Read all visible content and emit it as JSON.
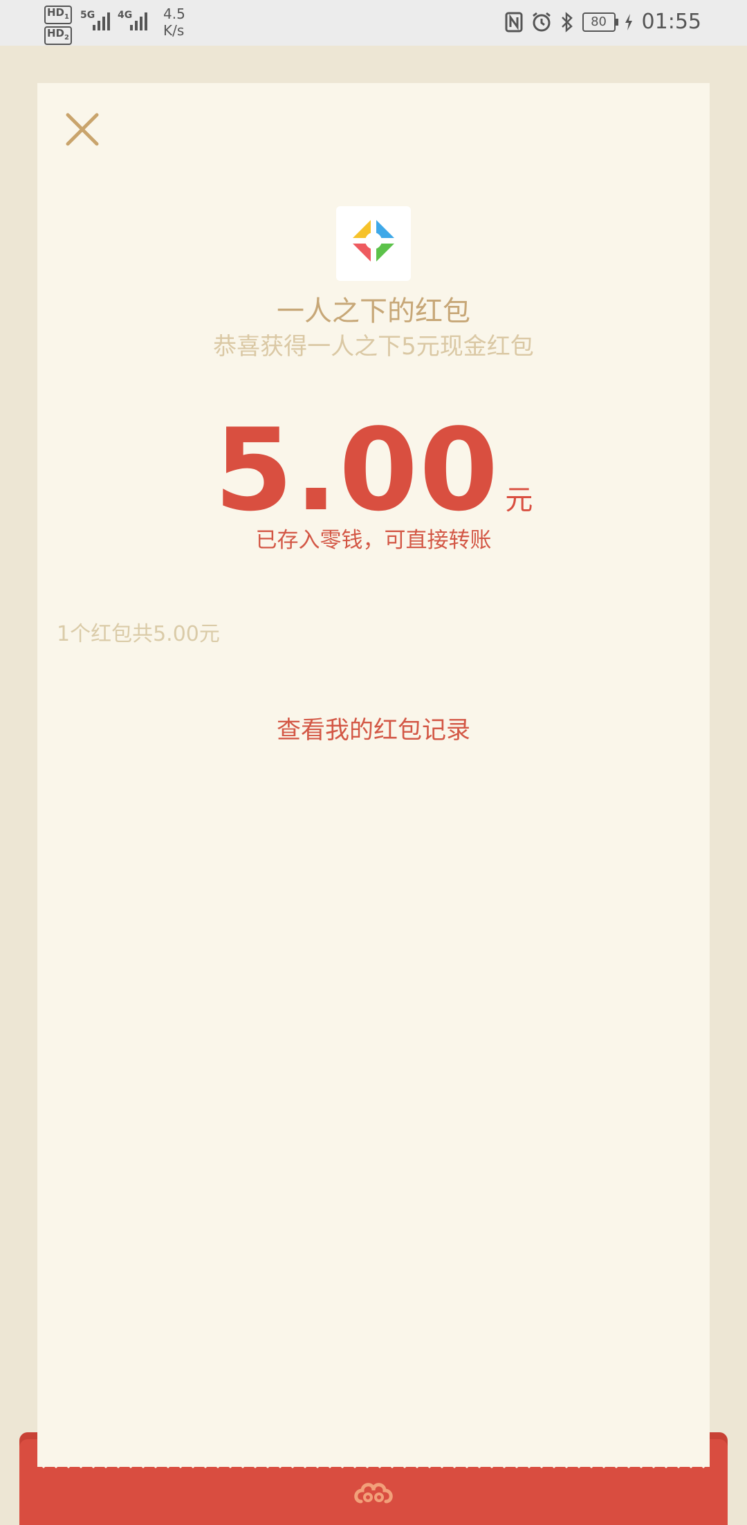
{
  "status_bar": {
    "hd1": "HD",
    "hd1_sub": "1",
    "hd2": "HD",
    "hd2_sub": "2",
    "net1": "5G",
    "net2": "4G",
    "speed_value": "4.5",
    "speed_unit": "K/s",
    "battery": "80",
    "time": "01:55",
    "icons": [
      "nfc-icon",
      "alarm-icon",
      "bluetooth-icon",
      "battery-icon",
      "charging-icon"
    ]
  },
  "envelope": {
    "close_icon": "close-icon",
    "app_logo": "app-logo-icon",
    "title": "一人之下的红包",
    "subtitle": "恭喜获得一人之下5元现金红包",
    "amount": "5.00",
    "amount_unit": "元",
    "stored_note": "已存入零钱，可直接转账",
    "summary": "1个红包共5.00元",
    "records_link": "查看我的红包记录",
    "bottom_icon": "cloud-icon"
  },
  "colors": {
    "page_bg": "#ede6d4",
    "card_bg": "#faf6ea",
    "accent_red": "#d94f40",
    "gold": "#c7a777",
    "light_gold": "#dacba8"
  }
}
